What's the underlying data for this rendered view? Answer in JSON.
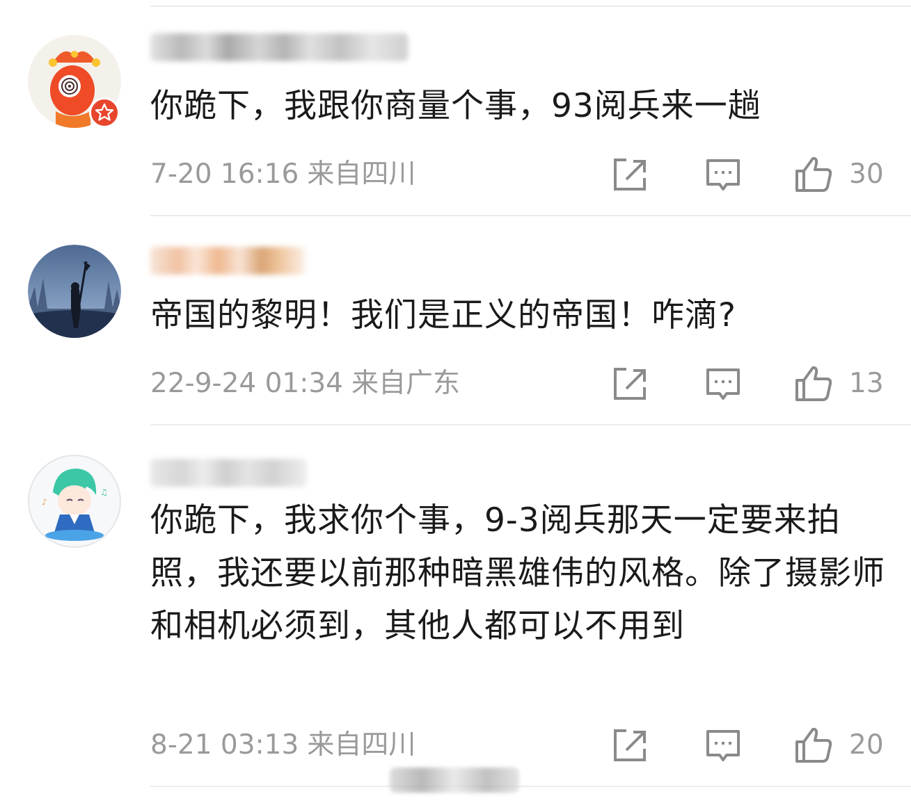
{
  "comments": [
    {
      "username": "",
      "text": "你跪下，我跟你商量个事，93阅兵来一趟",
      "time": "7-20 16:16",
      "location": "来自四川",
      "likes": "30",
      "avatar_icon": "jester-mascot-icon",
      "badge_icon": "star-badge-icon"
    },
    {
      "username": "",
      "text": "帝国的黎明！我们是正义的帝国！咋滴?",
      "time": "22-9-24 01:34",
      "location": "来自广东",
      "likes": "13",
      "avatar_icon": "knight-silhouette-icon"
    },
    {
      "username": "",
      "text": "你跪下，我求你个事，9-3阅兵那天一定要来拍照，我还要以前那种暗黑雄伟的风格。除了摄影师和相机必须到，其他人都可以不用到",
      "time": "8-21 03:13",
      "location": "来自四川",
      "likes": "20",
      "avatar_icon": "chibi-character-icon"
    }
  ],
  "icons": {
    "share": "share-icon",
    "reply": "reply-icon",
    "like": "thumbs-up-icon"
  },
  "colors": {
    "text": "#1a1a1a",
    "meta": "#9a9a9a",
    "icon": "#8a8a8a",
    "divider": "#ececec"
  }
}
